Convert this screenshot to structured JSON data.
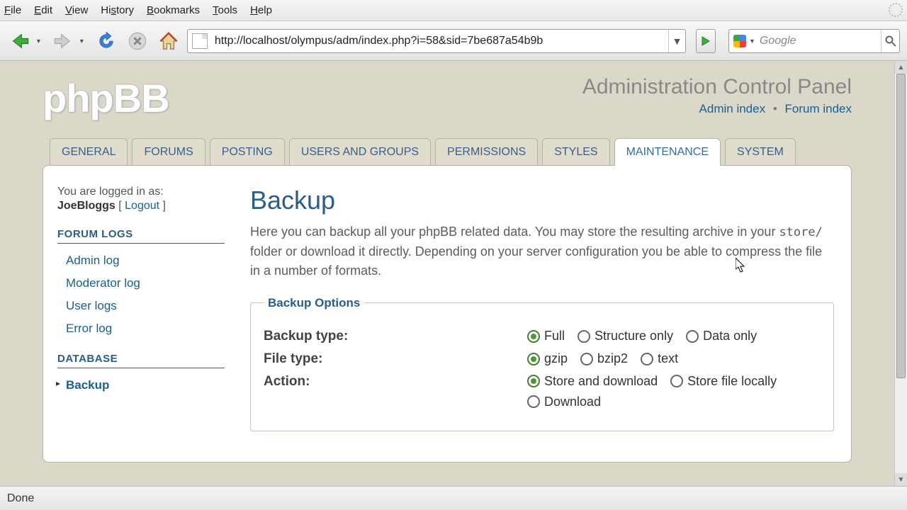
{
  "browser": {
    "menu": {
      "file": "File",
      "edit": "Edit",
      "view": "View",
      "history": "History",
      "bookmarks": "Bookmarks",
      "tools": "Tools",
      "help": "Help"
    },
    "url": "http://localhost/olympus/adm/index.php?i=58&sid=7be687a54b9b",
    "search_placeholder": "Google",
    "status": "Done"
  },
  "acp": {
    "logo_text": "phpBB",
    "title": "Administration Control Panel",
    "links": {
      "admin_index": "Admin index",
      "forum_index": "Forum index"
    },
    "tabs": [
      "GENERAL",
      "FORUMS",
      "POSTING",
      "USERS AND GROUPS",
      "PERMISSIONS",
      "STYLES",
      "MAINTENANCE",
      "SYSTEM"
    ],
    "active_tab": 6
  },
  "side": {
    "logged_label": "You are logged in as:",
    "username": "JoeBloggs",
    "logout": "Logout",
    "section1": "FORUM LOGS",
    "section1_items": [
      "Admin log",
      "Moderator log",
      "User logs",
      "Error log"
    ],
    "section2": "DATABASE",
    "section2_items": [
      "Backup"
    ],
    "current_section2": 0
  },
  "content": {
    "heading": "Backup",
    "desc_pre": "Here you can backup all your phpBB related data. You may store the resulting archive in your ",
    "desc_code": "store/",
    "desc_post": " folder or download it directly. Depending on your server configuration you be able to compress the file in a number of formats.",
    "fieldset_legend": "Backup Options",
    "rows": {
      "backup_type": {
        "label": "Backup type:",
        "options": [
          "Full",
          "Structure only",
          "Data only"
        ],
        "selected": 0
      },
      "file_type": {
        "label": "File type:",
        "options": [
          "gzip",
          "bzip2",
          "text"
        ],
        "selected": 0
      },
      "action": {
        "label": "Action:",
        "options": [
          "Store and download",
          "Store file locally",
          "Download"
        ],
        "selected": 0
      }
    }
  }
}
